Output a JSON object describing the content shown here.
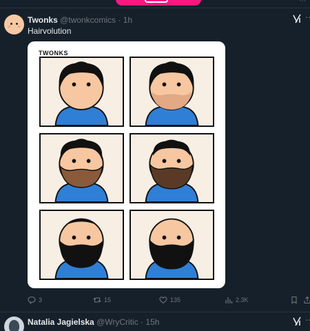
{
  "colors": {
    "background": "#15202b",
    "text": "#e7e9ea",
    "muted": "#71767b",
    "accent_pink": "#f91880",
    "divider": "#2f3336"
  },
  "tweets": [
    {
      "author_name": "Twonks",
      "handle": "@twonkcomics",
      "separator": "·",
      "time": "1h",
      "text": "Hairvolution",
      "image": {
        "comic_title": "TWONKS",
        "panels": 6
      },
      "actions": {
        "replies": "3",
        "retweets": "15",
        "likes": "135",
        "views": "2.3K"
      },
      "icons": [
        "grok-icon",
        "more-icon",
        "reply-icon",
        "retweet-icon",
        "like-icon",
        "views-icon",
        "bookmark-icon",
        "share-icon"
      ]
    },
    {
      "author_name": "Natalia Jagielska",
      "handle": "@WryCritic",
      "separator": "·",
      "time": "15h",
      "icons": [
        "grok-icon",
        "more-icon"
      ]
    }
  ]
}
